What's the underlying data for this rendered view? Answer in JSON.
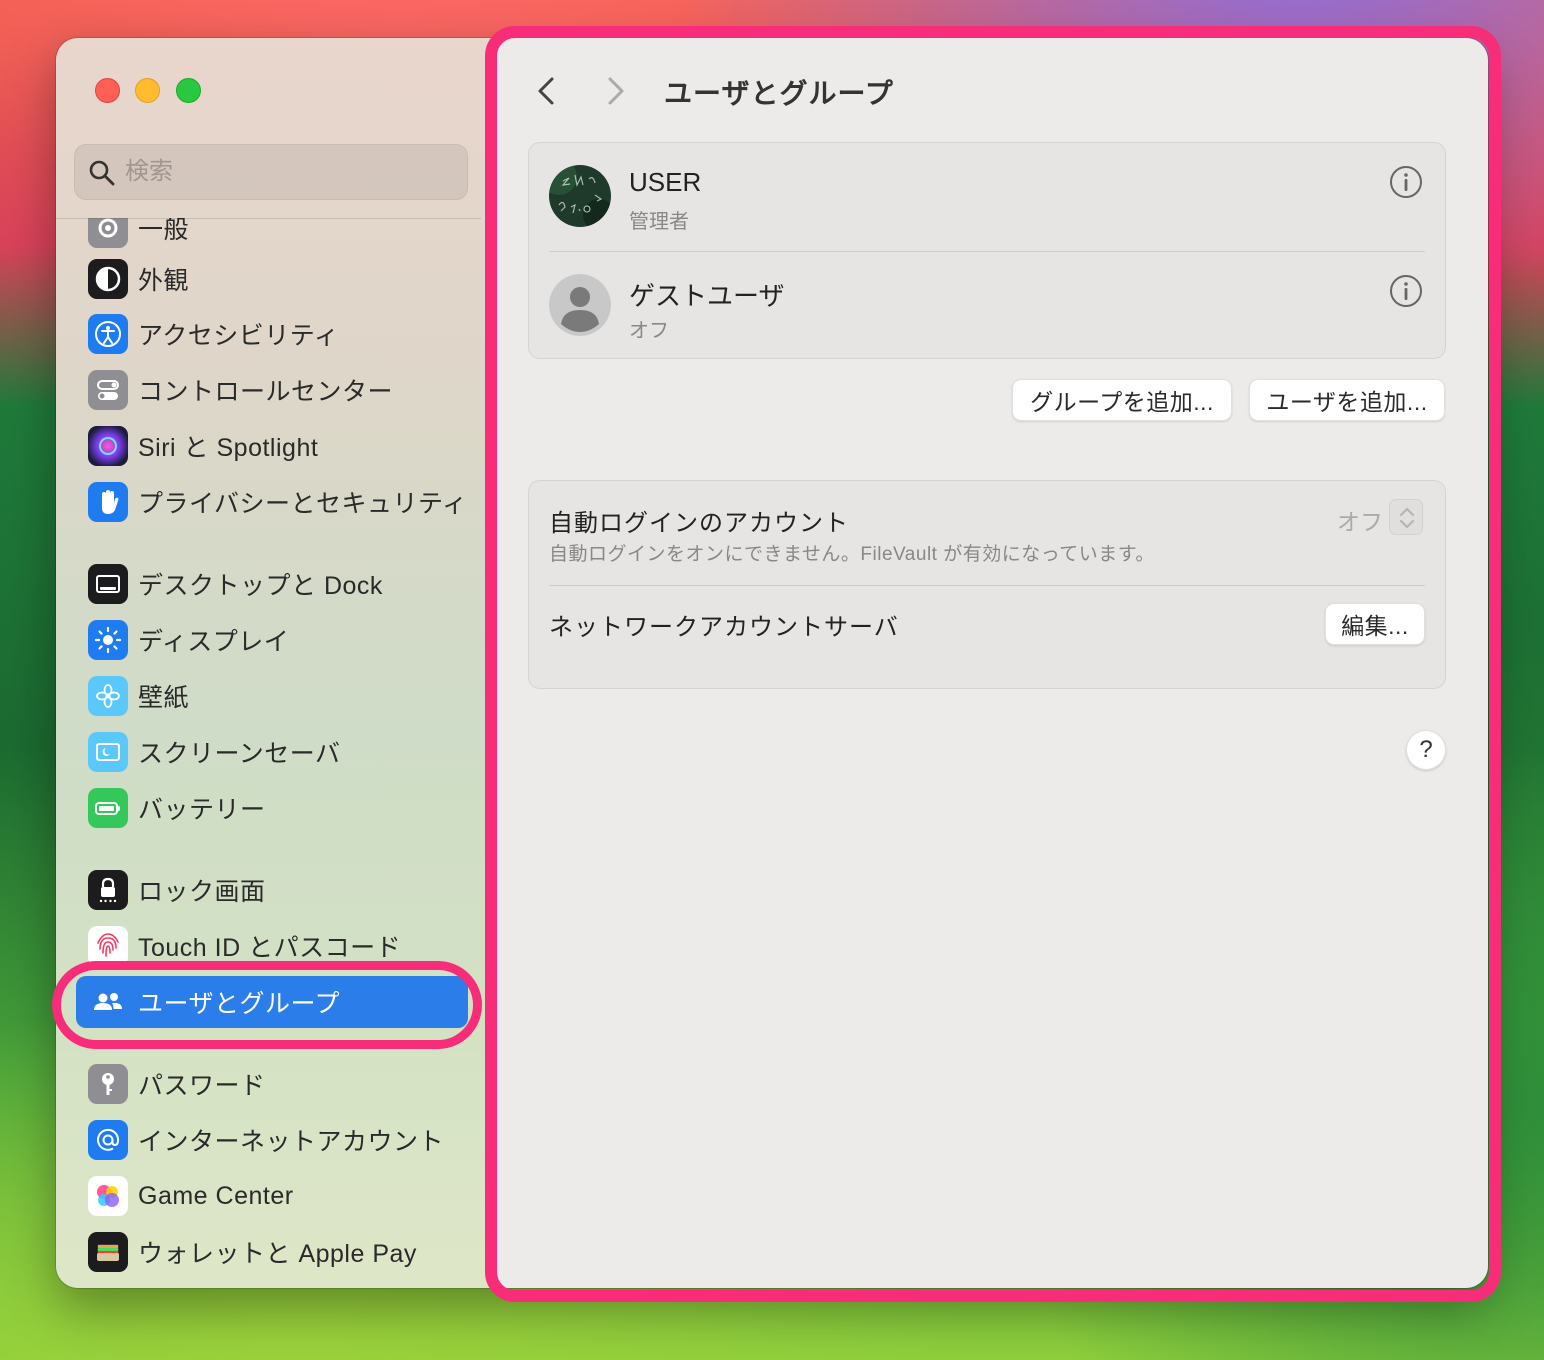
{
  "search": {
    "placeholder": "検索"
  },
  "sidebar": {
    "items": [
      {
        "label": "一般",
        "icon": "gear-icon"
      },
      {
        "label": "外観",
        "icon": "appearance-icon"
      },
      {
        "label": "アクセシビリティ",
        "icon": "accessibility-icon"
      },
      {
        "label": "コントロールセンター",
        "icon": "control-center-icon"
      },
      {
        "label": "Siri と Spotlight",
        "icon": "siri-icon"
      },
      {
        "label": "プライバシーとセキュリティ",
        "icon": "hand-icon"
      },
      {
        "label": "デスクトップと Dock",
        "icon": "dock-icon"
      },
      {
        "label": "ディスプレイ",
        "icon": "brightness-icon"
      },
      {
        "label": "壁紙",
        "icon": "flower-icon"
      },
      {
        "label": "スクリーンセーバ",
        "icon": "screensaver-icon"
      },
      {
        "label": "バッテリー",
        "icon": "battery-icon"
      },
      {
        "label": "ロック画面",
        "icon": "lock-icon"
      },
      {
        "label": "Touch ID とパスコード",
        "icon": "fingerprint-icon"
      },
      {
        "label": "ユーザとグループ",
        "icon": "users-icon",
        "selected": true
      },
      {
        "label": "パスワード",
        "icon": "key-icon"
      },
      {
        "label": "インターネットアカウント",
        "icon": "at-icon"
      },
      {
        "label": "Game Center",
        "icon": "game-center-icon"
      },
      {
        "label": "ウォレットと Apple Pay",
        "icon": "wallet-icon"
      }
    ]
  },
  "main": {
    "title": "ユーザとグループ",
    "users": [
      {
        "name": "USER",
        "role": "管理者"
      },
      {
        "name": "ゲストユーザ",
        "role": "オフ"
      }
    ],
    "add_group_label": "グループを追加...",
    "add_user_label": "ユーザを追加...",
    "auto_login": {
      "label": "自動ログインのアカウント",
      "value": "オフ",
      "note": "自動ログインをオンにできません。FileVault が有効になっています。"
    },
    "network_server": {
      "label": "ネットワークアカウントサーバ",
      "edit_label": "編集..."
    },
    "help_label": "?"
  },
  "colors": {
    "accent": "#2b7de9",
    "highlight": "#f72d7a"
  }
}
